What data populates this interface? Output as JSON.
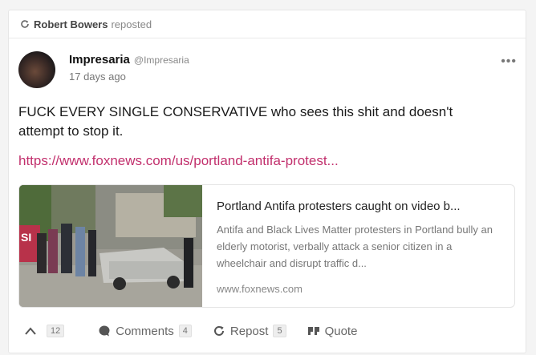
{
  "repost": {
    "user": "Robert Bowers",
    "verb": "reposted"
  },
  "author": {
    "name": "Impresaria",
    "handle": "@Impresaria",
    "time": "17 days ago"
  },
  "menu_glyph": "•••",
  "post": {
    "text": "FUCK EVERY SINGLE CONSERVATIVE who sees this shit and doesn't attempt to stop it.",
    "link": "https://www.foxnews.com/us/portland-antifa-protest..."
  },
  "preview": {
    "title": "Portland Antifa protesters caught on video b...",
    "description": "Antifa and Black Lives Matter protesters in Portland bully an elderly motorist, verbally attack a senior citizen in a wheelchair and disrupt traffic d...",
    "domain": "www.foxnews.com",
    "thumbnail_sign_text": "SI"
  },
  "actions": {
    "upvote_count": "12",
    "comments_label": "Comments",
    "comments_count": "4",
    "repost_label": "Repost",
    "repost_count": "5",
    "quote_label": "Quote"
  },
  "colors": {
    "link": "#c2306d",
    "muted": "#777777"
  },
  "icons": [
    "repost-icon",
    "upvote-icon",
    "comment-icon",
    "quote-icon",
    "more-icon"
  ]
}
